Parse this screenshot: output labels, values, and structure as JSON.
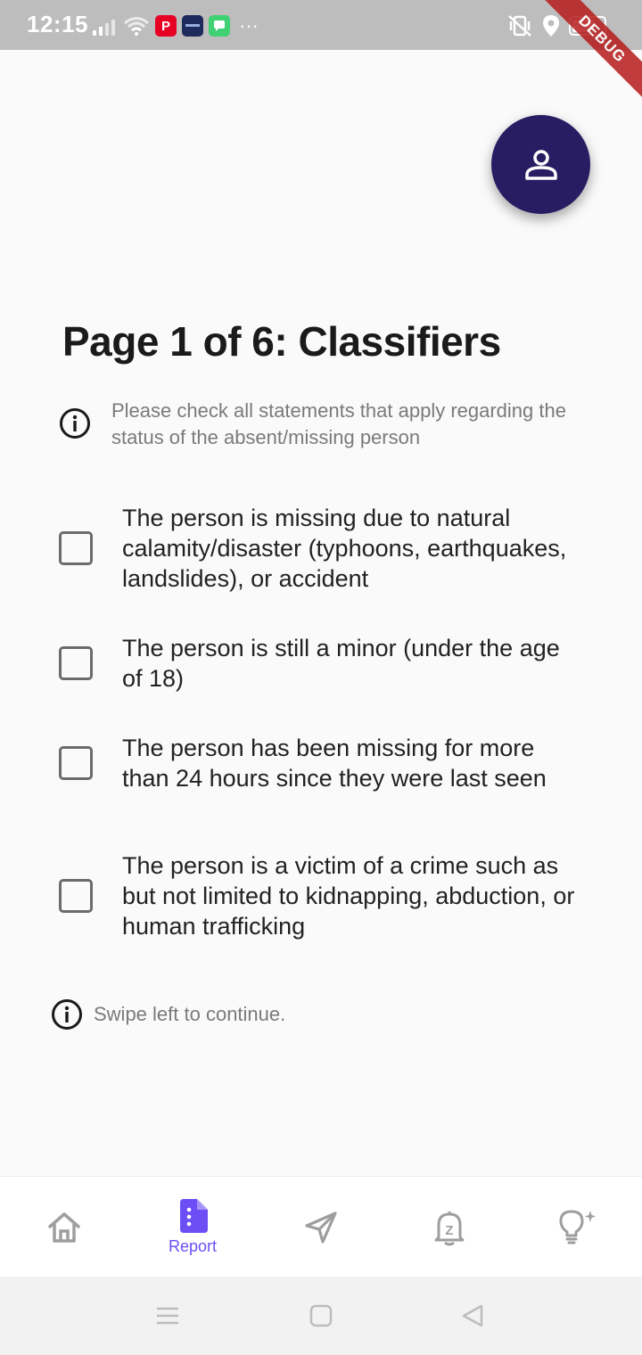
{
  "status_bar": {
    "time": "12:15",
    "battery": "70",
    "app_badges": [
      {
        "name": "pinterest",
        "glyph": "P",
        "color": "#e60023"
      },
      {
        "name": "news-app",
        "glyph": "",
        "color": "#1f2a5c"
      },
      {
        "name": "messages",
        "glyph": "",
        "color": "#3fd174"
      }
    ],
    "overflow": "···"
  },
  "debug_banner": "DEBUG",
  "page": {
    "title": "Page 1 of 6: Classifiers",
    "instruction": "Please check all statements that apply regarding the status of the absent/missing person",
    "swipe_hint": "Swipe left to continue."
  },
  "checklist": [
    {
      "label": "The person is missing due to natural calamity/disaster (typhoons, earthquakes, landslides), or accident",
      "checked": false
    },
    {
      "label": "The person is still a minor (under the age of 18)",
      "checked": false
    },
    {
      "label": "The person has been missing for more than 24 hours since they were last seen",
      "checked": false
    },
    {
      "label": "The person is a victim of a crime such as but not limited to kidnapping, abduction, or human trafficking",
      "checked": false
    }
  ],
  "bottom_nav": {
    "items": [
      {
        "name": "home",
        "icon": "home-icon",
        "label": ""
      },
      {
        "name": "report",
        "icon": "report-icon",
        "label": "Report",
        "active": true
      },
      {
        "name": "send",
        "icon": "send-icon",
        "label": ""
      },
      {
        "name": "notifications",
        "icon": "bell-icon",
        "label": ""
      },
      {
        "name": "tips",
        "icon": "lightbulb-icon",
        "label": ""
      }
    ]
  },
  "colors": {
    "accent": "#6c4ef5",
    "fab": "#281d63",
    "icon_inactive": "#9e9e9e"
  }
}
